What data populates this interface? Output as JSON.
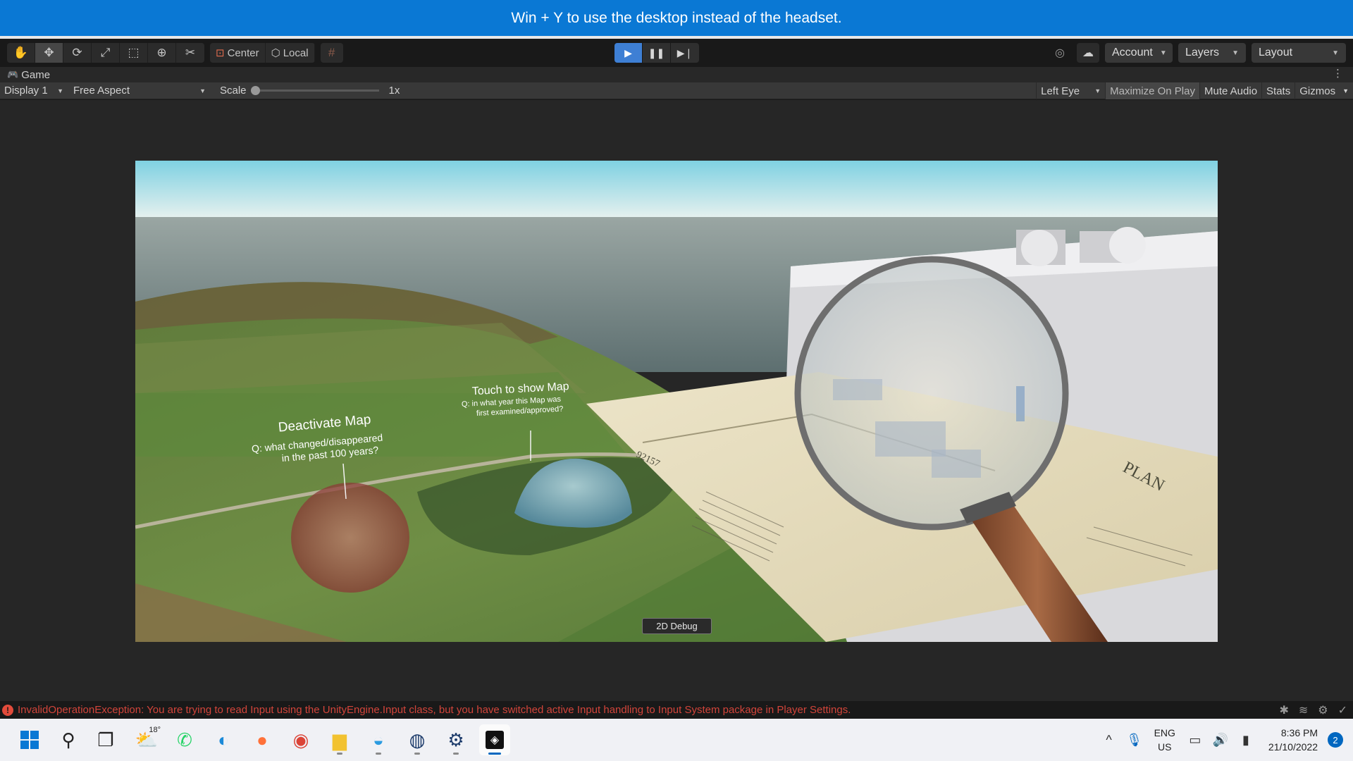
{
  "banner": {
    "text": "Win + Y to use the desktop instead of the headset."
  },
  "toolbar": {
    "tools": [
      "hand-icon",
      "move-icon",
      "rotate-icon",
      "scale-icon",
      "rect-icon",
      "transform-icon",
      "custom-tool-icon"
    ],
    "pivot_label": "Center",
    "space_label": "Local",
    "snap_icon": "grid-snap-icon",
    "account_label": "Account",
    "layers_label": "Layers",
    "layout_label": "Layout"
  },
  "tab": {
    "label": "Game"
  },
  "gamebar": {
    "display": "Display 1",
    "aspect": "Free Aspect",
    "scale_label": "Scale",
    "scale_value": "1x",
    "eye": "Left Eye",
    "maximize": "Maximize On Play",
    "mute": "Mute Audio",
    "stats": "Stats",
    "gizmos": "Gizmos"
  },
  "scene": {
    "deactivate_title": "Deactivate Map",
    "deactivate_question_1": "Q:  what  changed/disappeared",
    "deactivate_question_2": "in the past 100 years?",
    "touch_title": "Touch to show Map",
    "touch_question_1": "Q: in what year this Map was",
    "touch_question_2": "first examined/approved?",
    "map_number": "92157",
    "map_heading": "PLAN",
    "debug_button": "2D Debug"
  },
  "status": {
    "error": "InvalidOperationException: You are trying to read Input using the UnityEngine.Input class, but you have switched active Input handling to Input System package in Player Settings."
  },
  "taskbar": {
    "weather_temp": "18°",
    "lang_1": "ENG",
    "lang_2": "US",
    "time": "8:36 PM",
    "date": "21/10/2022",
    "notifications": "2"
  }
}
